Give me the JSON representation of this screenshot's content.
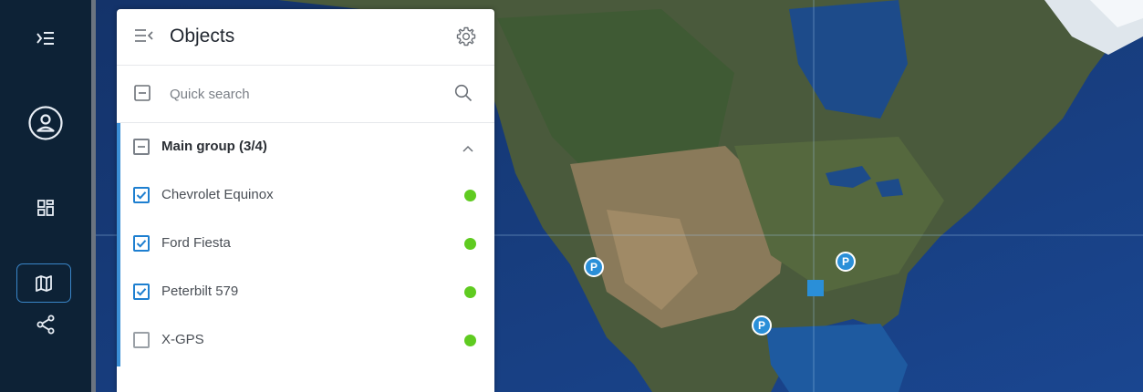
{
  "sidebar": {
    "items": [
      {
        "icon": "menu-expand-icon"
      },
      {
        "icon": "user-circle-icon"
      },
      {
        "icon": "dashboard-icon"
      },
      {
        "icon": "map-icon",
        "active": true
      },
      {
        "icon": "share-icon"
      }
    ]
  },
  "panel": {
    "title": "Objects",
    "search": {
      "placeholder": "Quick search",
      "value": ""
    },
    "group": {
      "label": "Main group (3/4)",
      "state": "partial",
      "expanded": true
    },
    "objects": [
      {
        "label": "Chevrolet Equinox",
        "checked": true,
        "status_color": "#5fcb20"
      },
      {
        "label": "Ford Fiesta",
        "checked": true,
        "status_color": "#5fcb20"
      },
      {
        "label": "Peterbilt 579",
        "checked": true,
        "status_color": "#5fcb20"
      },
      {
        "label": "X-GPS",
        "checked": false,
        "status_color": "#5fcb20"
      }
    ]
  },
  "map": {
    "markers": [
      {
        "label": "P"
      },
      {
        "label": "P"
      },
      {
        "label": "P"
      }
    ]
  },
  "colors": {
    "sidebar_bg": "#0d2236",
    "accent": "#3b8fd6",
    "status_online": "#5fcb20",
    "marker": "#2a8fd8"
  }
}
